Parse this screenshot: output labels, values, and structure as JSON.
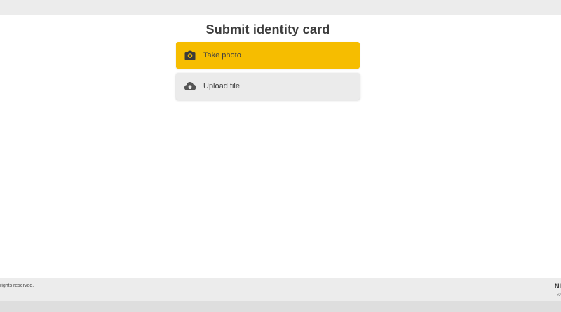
{
  "header": {},
  "main": {
    "title": "Submit identity card",
    "options": [
      {
        "label": "Take photo",
        "icon": "camera-icon",
        "color": "#f6bd00"
      },
      {
        "label": "Upload file",
        "icon": "cloud-upload-icon",
        "color": "#ebebeb"
      }
    ]
  },
  "footer": {
    "copyright": "rights reserved.",
    "brand": "NI",
    "brand_sub": "ور"
  },
  "colors": {
    "accent": "#f6bd00",
    "surface": "#ebebeb",
    "text": "#3c3c3c"
  }
}
